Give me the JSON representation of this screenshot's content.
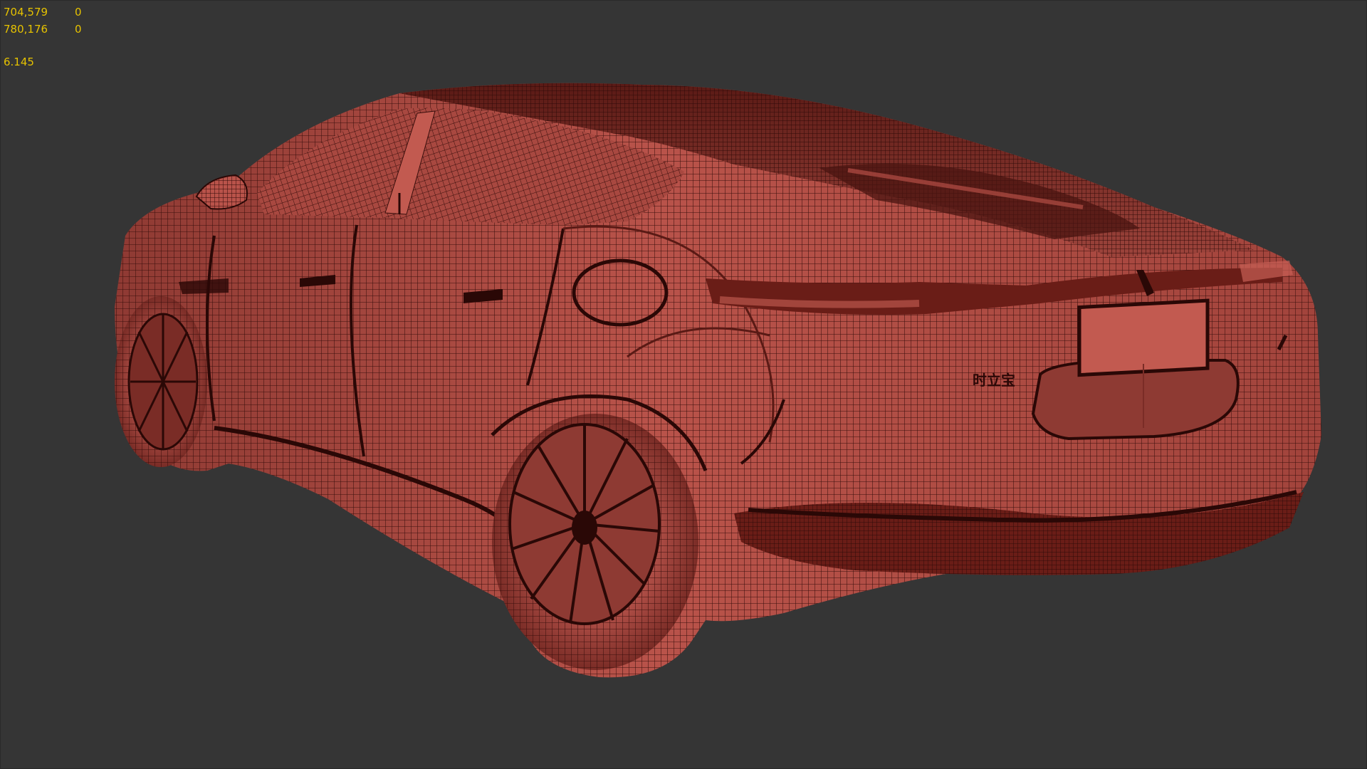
{
  "viewport": {
    "stats": {
      "polys": {
        "value": "704,579",
        "selected": "0"
      },
      "verts": {
        "value": "780,176",
        "selected": "0"
      },
      "fps": "6.145"
    },
    "background_color": "#353535",
    "mesh": {
      "description_icon": "car-wireframe-model",
      "shade_color": "#b9534a",
      "wire_color": "#3a0f0c",
      "dark_color": "#2a0806",
      "rear_badge": "时立宝"
    }
  }
}
